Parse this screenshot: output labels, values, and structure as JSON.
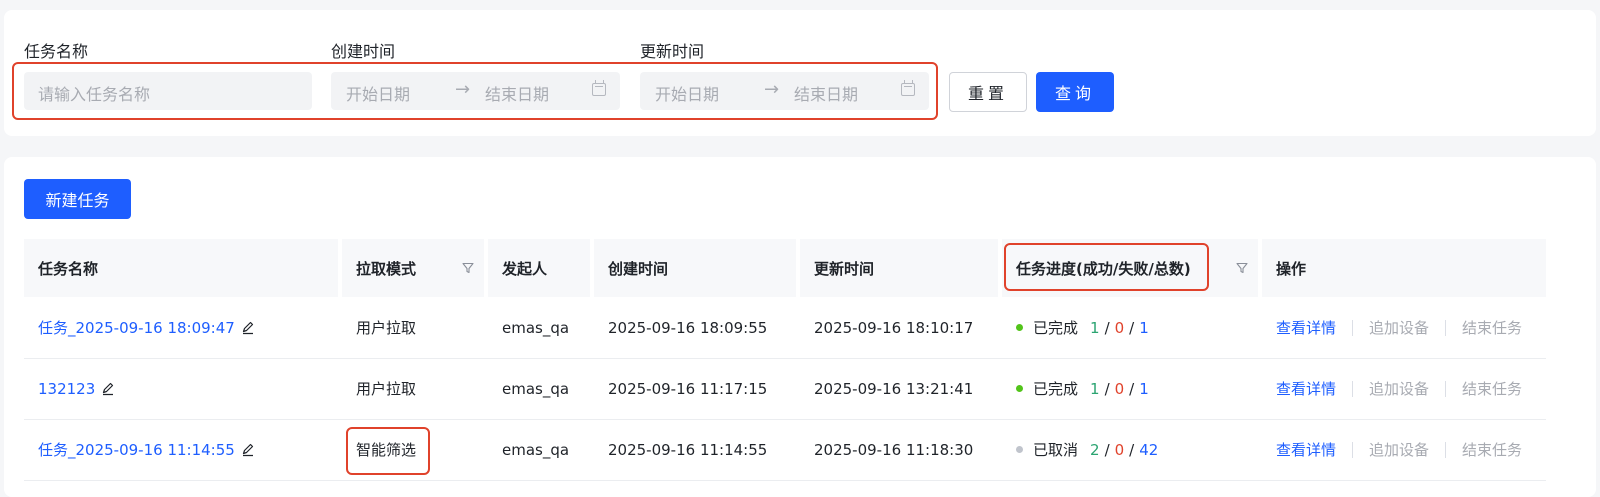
{
  "search": {
    "task_name_label": "任务名称",
    "task_name_placeholder": "请输入任务名称",
    "created_label": "创建时间",
    "updated_label": "更新时间",
    "start_placeholder": "开始日期",
    "end_placeholder": "结束日期",
    "arrow": "→",
    "reset_label": "重置",
    "query_label": "查询"
  },
  "toolbar": {
    "new_task_label": "新建任务"
  },
  "table": {
    "headers": {
      "name": "任务名称",
      "mode": "拉取模式",
      "initiator": "发起人",
      "created": "创建时间",
      "updated": "更新时间",
      "progress": "任务进度(成功/失败/总数)",
      "actions": "操作"
    },
    "rows": [
      {
        "name": "任务_2025-09-16 18:09:47",
        "mode": "用户拉取",
        "initiator": "emas_qa",
        "created": "2025-09-16 18:09:55",
        "updated": "2025-09-16 18:10:17",
        "status": "已完成",
        "status_color": "#52c41a",
        "success": "1",
        "fail": "0",
        "total": "1"
      },
      {
        "name": "132123",
        "mode": "用户拉取",
        "initiator": "emas_qa",
        "created": "2025-09-16 11:17:15",
        "updated": "2025-09-16 13:21:41",
        "status": "已完成",
        "status_color": "#52c41a",
        "success": "1",
        "fail": "0",
        "total": "1"
      },
      {
        "name": "任务_2025-09-16 11:14:55",
        "mode": "智能筛选",
        "initiator": "emas_qa",
        "created": "2025-09-16 11:14:55",
        "updated": "2025-09-16 11:18:30",
        "status": "已取消",
        "status_color": "#c0c4cc",
        "success": "2",
        "fail": "0",
        "total": "42"
      }
    ],
    "actions": {
      "view": "查看详情",
      "add_device": "追加设备",
      "end_task": "结束任务"
    },
    "slash": "/"
  },
  "colors": {
    "primary": "#1e5eff",
    "highlight": "#e0422b",
    "success": "#2ba471",
    "fail": "#e0422b"
  }
}
